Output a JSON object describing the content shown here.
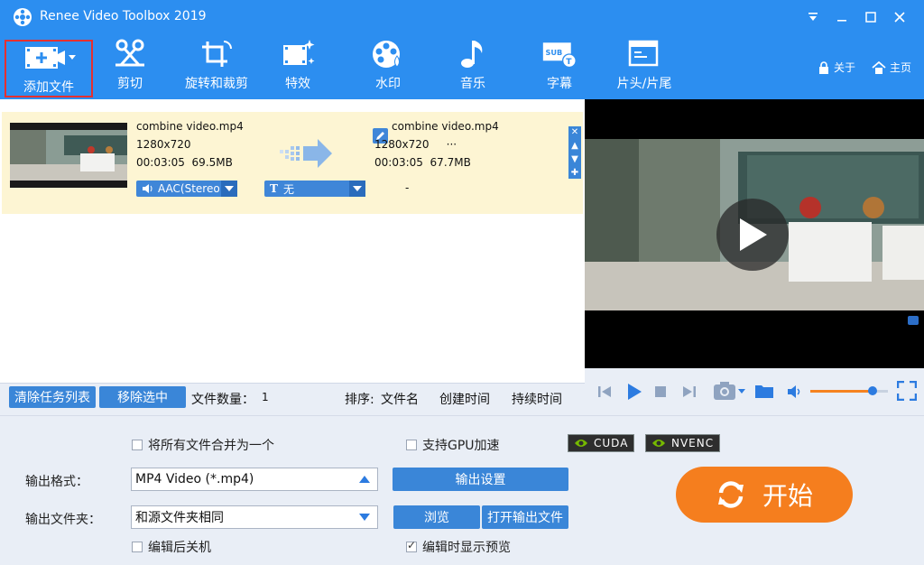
{
  "app": {
    "title": "Renee Video Toolbox 2019"
  },
  "window_controls": {
    "menu": "menu-icon",
    "minimize": "minimize-icon",
    "maximize": "maximize-icon",
    "close": "close-icon"
  },
  "toolbar": {
    "items": [
      {
        "label": "添加文件",
        "icon": "add-file-icon"
      },
      {
        "label": "剪切",
        "icon": "scissors-icon"
      },
      {
        "label": "旋转和裁剪",
        "icon": "crop-rotate-icon"
      },
      {
        "label": "特效",
        "icon": "effects-icon"
      },
      {
        "label": "水印",
        "icon": "watermark-icon"
      },
      {
        "label": "音乐",
        "icon": "music-note-icon"
      },
      {
        "label": "字幕",
        "icon": "subtitle-icon"
      },
      {
        "label": "片头/片尾",
        "icon": "intro-outro-icon"
      }
    ],
    "about_label": "关于",
    "home_label": "主页"
  },
  "file_row": {
    "source": {
      "name": "combine video.mp4",
      "resolution": "1280x720",
      "duration": "00:03:05",
      "size": "69.5MB"
    },
    "output": {
      "name": "combine video.mp4",
      "resolution": "1280x720",
      "more": "···",
      "duration": "00:03:05",
      "size": "67.7MB"
    },
    "audio_track": "AAC(Stereo 4",
    "subtitle_track": "无",
    "extra": "-"
  },
  "list_bar": {
    "clear_label": "清除任务列表",
    "remove_label": "移除选中",
    "count_label": "文件数量：",
    "count_value": "1",
    "sort_label": "排序:",
    "sort_by_name": "文件名",
    "sort_by_created": "创建时间",
    "sort_by_duration": "持续时间"
  },
  "settings": {
    "merge_label": "将所有文件合并为一个",
    "merge_checked": false,
    "gpu_label": "支持GPU加速",
    "gpu_checked": false,
    "cuda_label": "CUDA",
    "nvenc_label": "NVENC",
    "format_label": "输出格式：",
    "format_value": "MP4 Video (*.mp4)",
    "output_settings_label": "输出设置",
    "folder_label": "输出文件夹：",
    "folder_value": "和源文件夹相同",
    "browse_label": "浏览",
    "open_output_label": "打开输出文件",
    "shutdown_label": "编辑后关机",
    "shutdown_checked": false,
    "preview_label": "编辑时显示预览",
    "preview_checked": true,
    "start_label": "开始"
  },
  "player": {
    "volume_fraction": 0.8
  },
  "colors": {
    "header": "#2c8ef0",
    "accent": "#3a86d8",
    "row_highlight": "#fdf5d3",
    "start": "#f57e1e"
  }
}
